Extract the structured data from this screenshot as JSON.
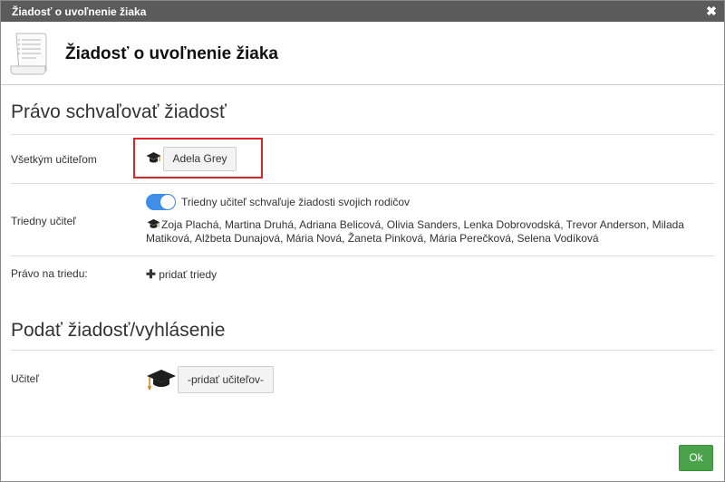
{
  "window": {
    "title": "Žiadosť o uvoľnenie žiaka",
    "close_symbol": "✖"
  },
  "header": {
    "title": "Žiadosť o uvoľnenie žiaka",
    "icon": "document-scroll-icon"
  },
  "approve_section": {
    "title": "Právo schvaľovať žiadosť",
    "all_teachers": {
      "label": "Všetkým učiteľom",
      "icon": "graduation-cap-icon",
      "button_label": "Adela Grey"
    },
    "class_teacher": {
      "label": "Triedny učiteľ",
      "toggle_on": true,
      "toggle_label": "Triedny učiteľ schvaľuje žiadosti svojich rodičov",
      "teachers_line1": "Zoja Plachá, Martina Druhá, Adriana Belicová, Olivia Sanders, Lenka Dobrovodská, Trevor Anderson, Milada",
      "teachers_line2": "Matiková, Alžbeta Dunajová, Mária Nová, Žaneta Pinková, Mária Perečková, Selena Vodíková"
    },
    "class_right": {
      "label": "Právo na triedu:",
      "add_label": "pridať triedy"
    }
  },
  "submit_section": {
    "title": "Podať žiadosť/vyhlásenie",
    "teacher": {
      "label": "Učiteľ",
      "button_label": "-pridať učiteľov-"
    }
  },
  "footer": {
    "ok_label": "Ok"
  },
  "colors": {
    "titlebar": "#5b5b5b",
    "highlight": "#d9262c",
    "toggle": "#3f8ee9",
    "ok": "#4aa34a"
  }
}
